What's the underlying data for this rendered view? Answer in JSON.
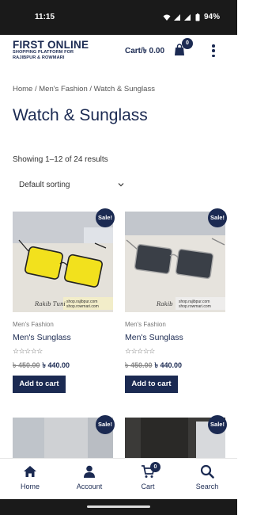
{
  "status_bar": {
    "time": "11:15",
    "battery": "94%"
  },
  "header": {
    "logo_line1": "FIRST ONLINE",
    "logo_line2": "SHOPPING PLATFORM FOR",
    "logo_line3": "RAJIBPUR & ROWMARI",
    "cart_text": "Cart/৳ 0.00",
    "cart_count": "0"
  },
  "breadcrumb": {
    "home": "Home",
    "sep": " / ",
    "category": "Men's Fashion",
    "current": "Watch & Sunglass"
  },
  "page_title": "Watch & Sunglass",
  "results_text": "Showing 1–12 of 24 results",
  "sort": {
    "selected": "Default sorting"
  },
  "products": [
    {
      "badge": "Sale!",
      "category": "Men's Fashion",
      "name": "Men's Sunglass",
      "stars": "☆☆☆☆☆",
      "old_price": "৳ 450.00",
      "price": "৳ 440.00",
      "button": "Add to cart",
      "watermark": "shop.rajibpur.com shop.rowmari.com",
      "lens_color": "#f2e11d"
    },
    {
      "badge": "Sale!",
      "category": "Men's Fashion",
      "name": "Men's Sunglass",
      "stars": "☆☆☆☆☆",
      "old_price": "৳ 450.00",
      "price": "৳ 440.00",
      "button": "Add to cart",
      "watermark": "shop.rajibpur.com shop.rowmari.com",
      "lens_color": "#3a3f47"
    },
    {
      "badge": "Sale!"
    },
    {
      "badge": "Sale!"
    }
  ],
  "bottom_nav": {
    "home": "Home",
    "account": "Account",
    "cart": "Cart",
    "cart_count": "0",
    "search": "Search"
  }
}
